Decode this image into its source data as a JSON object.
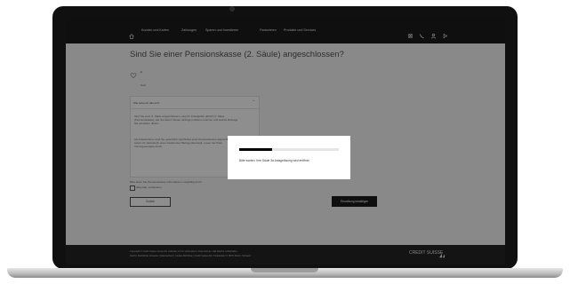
{
  "nav": {
    "items": [
      "Kunden und Karten",
      "Zahlungen",
      "Sparen und Investieren",
      "Finanzieren",
      "Produkte und Services"
    ]
  },
  "page": {
    "title": "Sind Sie einer Pensionskasse (2. Säule) angeschlossen?",
    "option_yes": "Ja",
    "option_no": "Nein"
  },
  "card": {
    "title": "Wie sehe ich das ein?",
    "paragraph1": "Sind Sie einer 2. Säule angeschlossen, sagt Ihr Arbeitgeber jährlich 2. Säule (Pensionskasse), wie Sie davon Steuer-Abzüge profitieren können und welche Beiträge Sie einzahlen dürfen.",
    "paragraph2": "Als Arbeitnehmer sind Sie gesetzlich verpflichtet einer Pensionskasse angeschlossen, sofern Ihr Jahreslohn einen bestimmten Betrag übersteigt. Lesen Sie Ihren Vorsorgeausweis durch."
  },
  "consent": {
    "text": "Bitte lesen Sie Pensionskasse-Informationen sorgfältig durch.",
    "checkbox_label": "Alles klar, verstanden"
  },
  "buttons": {
    "back": "Zurück",
    "add": "Einzahlung bestätigen"
  },
  "footer": {
    "line1": "Copyright © Credit Suisse Group AG und/oder mit ihr verbundene Unternehmen. Alle Rechte vorbehalten.",
    "line2": "Recht  |  Rechtliche Hinweise  |  Datenschutz  |  Cookie-Richtlinie  |  Credit Suisse AG, Paradeplatz 8, 8070 Zürich, Schweiz",
    "logo": "CREDIT SUISSE"
  },
  "modal": {
    "message": "Bitte warten: Ihre Säule 3a Anlagelösung wird eröffnet.",
    "progress": 0.33
  }
}
